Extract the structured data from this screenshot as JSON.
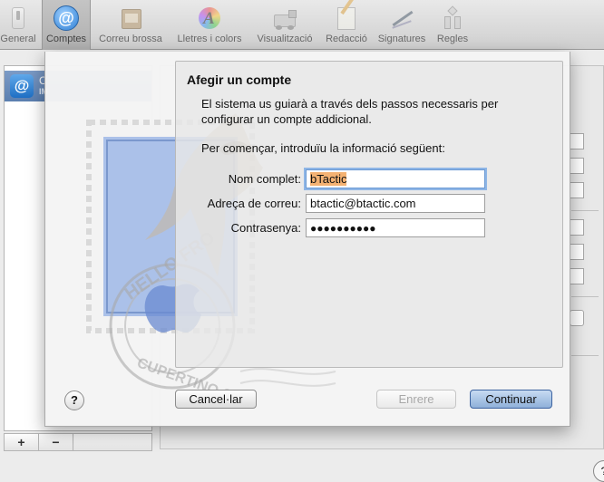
{
  "toolbar": {
    "items": [
      {
        "label": "General",
        "icon": "switch-icon"
      },
      {
        "label": "Comptes",
        "icon": "at-icon"
      },
      {
        "label": "Correu brossa",
        "icon": "junk-mail-icon"
      },
      {
        "label": "Lletres i colors",
        "icon": "fonts-colors-icon"
      },
      {
        "label": "Visualització",
        "icon": "viewing-icon"
      },
      {
        "label": "Redacció",
        "icon": "composing-icon"
      },
      {
        "label": "Signatures",
        "icon": "signature-icon"
      },
      {
        "label": "Regles",
        "icon": "rules-icon"
      }
    ],
    "selected": "Comptes"
  },
  "accounts": {
    "items": [
      {
        "name": "C",
        "type": "IM"
      }
    ],
    "add_button": "+",
    "remove_button": "−"
  },
  "sheet": {
    "title": "Afegir un compte",
    "description": "El sistema us guiarà a través dels passos necessaris per configurar un compte addicional.",
    "intro": "Per començar, introduïu la informació següent:",
    "fields": {
      "full_name": {
        "label": "Nom complet:",
        "value": "bTactic"
      },
      "email": {
        "label": "Adreça de correu:",
        "value": "btactic@btactic.com"
      },
      "password": {
        "label": "Contrasenya:",
        "value": "●●●●●●●●●●"
      }
    },
    "buttons": {
      "help": "?",
      "cancel": "Cancel·lar",
      "back": "Enrere",
      "continue": "Continuar"
    }
  },
  "background_panel": {
    "help": "?"
  },
  "colors": {
    "accent": "#8fb0d9",
    "selection": "#f4b273",
    "focus_ring": "#8fb6e6"
  }
}
